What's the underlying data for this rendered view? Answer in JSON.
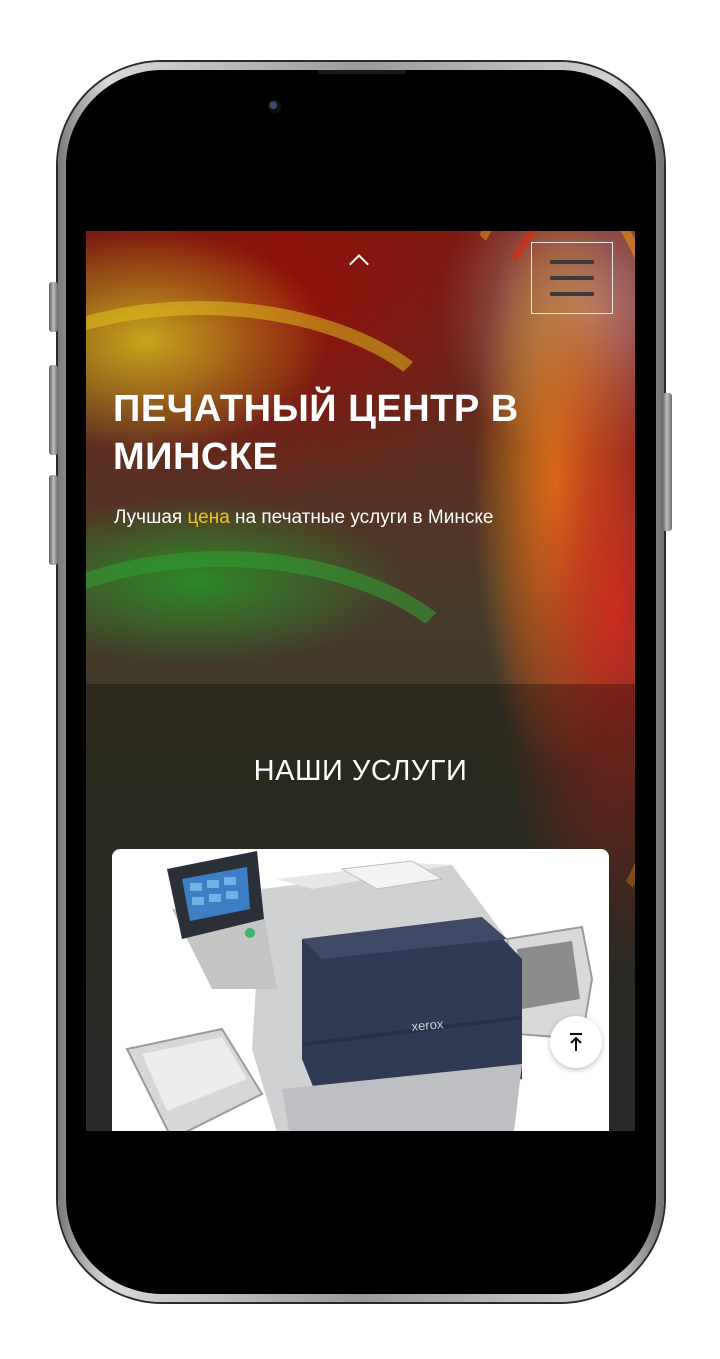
{
  "header": {
    "menu_icon": "hamburger-icon",
    "collapse_icon": "chevron-up-icon"
  },
  "hero": {
    "title": "ПЕЧАТНЫЙ ЦЕНТР В МИНСКЕ",
    "subtitle_before": "Лучшая ",
    "subtitle_accent": "цена",
    "subtitle_after": " на печатные услуги в Минске",
    "accent_color": "#f4c220"
  },
  "services": {
    "title": "НАШИ УСЛУГИ",
    "card_image": "xerox-printer",
    "printer_brand": "xerox"
  },
  "scroll_top": {
    "icon": "arrow-up-to-top-icon"
  }
}
